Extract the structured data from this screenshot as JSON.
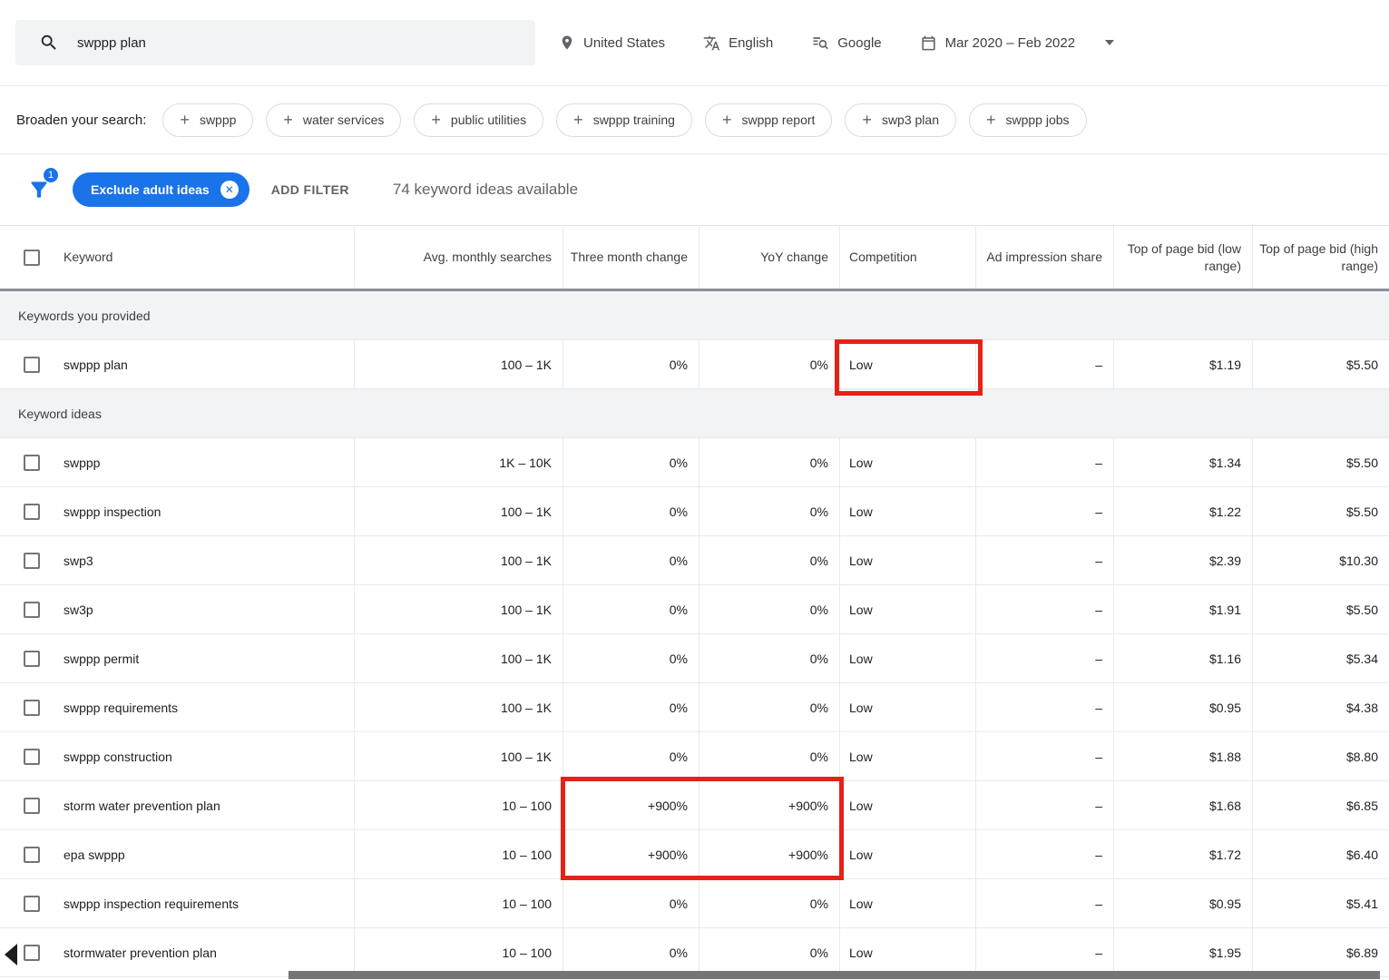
{
  "colors": {
    "accent": "#1a73e8",
    "annotation_red": "#e62117",
    "search_bg": "#f1f3f4"
  },
  "topbar": {
    "search_value": "swppp plan",
    "location": "United States",
    "language": "English",
    "network": "Google",
    "date_range": "Mar 2020 – Feb 2022"
  },
  "broaden": {
    "label": "Broaden your search:",
    "chips": [
      "swppp",
      "water services",
      "public utilities",
      "swppp training",
      "swppp report",
      "swp3 plan",
      "swppp jobs"
    ]
  },
  "filter_bar": {
    "filter_count_badge": "1",
    "exclude_filter_label": "Exclude adult ideas",
    "add_filter_label": "ADD FILTER",
    "ideas_available": "74 keyword ideas available"
  },
  "table": {
    "columns": [
      "Keyword",
      "Avg. monthly searches",
      "Three month change",
      "YoY change",
      "Competition",
      "Ad impression share",
      "Top of page bid (low range)",
      "Top of page bid (high range)"
    ],
    "sections": [
      {
        "label": "Keywords you provided",
        "rows": [
          {
            "keyword": "swppp plan",
            "avg_monthly_searches": "100 – 1K",
            "three_month_change": "0%",
            "yoy_change": "0%",
            "competition": "Low",
            "ad_impression_share": "–",
            "bid_low": "$1.19",
            "bid_high": "$5.50"
          }
        ]
      },
      {
        "label": "Keyword ideas",
        "rows": [
          {
            "keyword": "swppp",
            "avg_monthly_searches": "1K – 10K",
            "three_month_change": "0%",
            "yoy_change": "0%",
            "competition": "Low",
            "ad_impression_share": "–",
            "bid_low": "$1.34",
            "bid_high": "$5.50"
          },
          {
            "keyword": "swppp inspection",
            "avg_monthly_searches": "100 – 1K",
            "three_month_change": "0%",
            "yoy_change": "0%",
            "competition": "Low",
            "ad_impression_share": "–",
            "bid_low": "$1.22",
            "bid_high": "$5.50"
          },
          {
            "keyword": "swp3",
            "avg_monthly_searches": "100 – 1K",
            "three_month_change": "0%",
            "yoy_change": "0%",
            "competition": "Low",
            "ad_impression_share": "–",
            "bid_low": "$2.39",
            "bid_high": "$10.30"
          },
          {
            "keyword": "sw3p",
            "avg_monthly_searches": "100 – 1K",
            "three_month_change": "0%",
            "yoy_change": "0%",
            "competition": "Low",
            "ad_impression_share": "–",
            "bid_low": "$1.91",
            "bid_high": "$5.50"
          },
          {
            "keyword": "swppp permit",
            "avg_monthly_searches": "100 – 1K",
            "three_month_change": "0%",
            "yoy_change": "0%",
            "competition": "Low",
            "ad_impression_share": "–",
            "bid_low": "$1.16",
            "bid_high": "$5.34"
          },
          {
            "keyword": "swppp requirements",
            "avg_monthly_searches": "100 – 1K",
            "three_month_change": "0%",
            "yoy_change": "0%",
            "competition": "Low",
            "ad_impression_share": "–",
            "bid_low": "$0.95",
            "bid_high": "$4.38"
          },
          {
            "keyword": "swppp construction",
            "avg_monthly_searches": "100 – 1K",
            "three_month_change": "0%",
            "yoy_change": "0%",
            "competition": "Low",
            "ad_impression_share": "–",
            "bid_low": "$1.88",
            "bid_high": "$8.80"
          },
          {
            "keyword": "storm water prevention plan",
            "avg_monthly_searches": "10 – 100",
            "three_month_change": "+900%",
            "yoy_change": "+900%",
            "competition": "Low",
            "ad_impression_share": "–",
            "bid_low": "$1.68",
            "bid_high": "$6.85"
          },
          {
            "keyword": "epa swppp",
            "avg_monthly_searches": "10 – 100",
            "three_month_change": "+900%",
            "yoy_change": "+900%",
            "competition": "Low",
            "ad_impression_share": "–",
            "bid_low": "$1.72",
            "bid_high": "$6.40"
          },
          {
            "keyword": "swppp inspection requirements",
            "avg_monthly_searches": "10 – 100",
            "three_month_change": "0%",
            "yoy_change": "0%",
            "competition": "Low",
            "ad_impression_share": "–",
            "bid_low": "$0.95",
            "bid_high": "$5.41"
          },
          {
            "keyword": "stormwater prevention plan",
            "avg_monthly_searches": "10 – 100",
            "three_month_change": "0%",
            "yoy_change": "0%",
            "competition": "Low",
            "ad_impression_share": "–",
            "bid_low": "$1.95",
            "bid_high": "$6.89"
          }
        ]
      }
    ]
  }
}
